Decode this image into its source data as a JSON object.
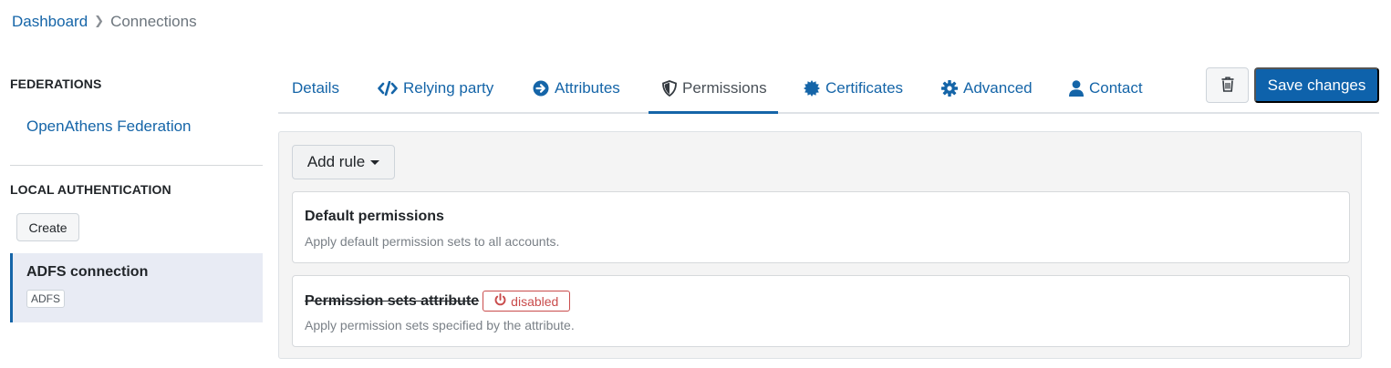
{
  "breadcrumb": {
    "items": [
      "Dashboard",
      "Connections"
    ]
  },
  "sidebar": {
    "federations_heading": "FEDERATIONS",
    "federation_link": "OpenAthens Federation",
    "local_heading": "LOCAL AUTHENTICATION",
    "create_label": "Create",
    "connection": {
      "name": "ADFS connection",
      "type": "ADFS"
    }
  },
  "tabs": [
    {
      "label": "Details",
      "icon": "none"
    },
    {
      "label": "Relying party",
      "icon": "code-icon"
    },
    {
      "label": "Attributes",
      "icon": "arrow-circle-right-icon"
    },
    {
      "label": "Permissions",
      "icon": "shield-icon"
    },
    {
      "label": "Certificates",
      "icon": "certificate-icon"
    },
    {
      "label": "Advanced",
      "icon": "gear-icon"
    },
    {
      "label": "Contact",
      "icon": "user-icon"
    }
  ],
  "active_tab": "Permissions",
  "toolbar": {
    "delete_icon": "trash-icon",
    "save_label": "Save changes"
  },
  "panel": {
    "add_rule_label": "Add rule",
    "rules": [
      {
        "title": "Default permissions",
        "description": "Apply default permission sets to all accounts."
      },
      {
        "title": "Permission sets attribute",
        "status": "disabled",
        "description": "Apply permission sets specified by the attribute."
      }
    ]
  },
  "colors": {
    "link": "#1565a8",
    "primary_button": "#0e62ab",
    "disabled_badge": "#c94c4c",
    "selected_item_bg": "#e8ebf4"
  }
}
